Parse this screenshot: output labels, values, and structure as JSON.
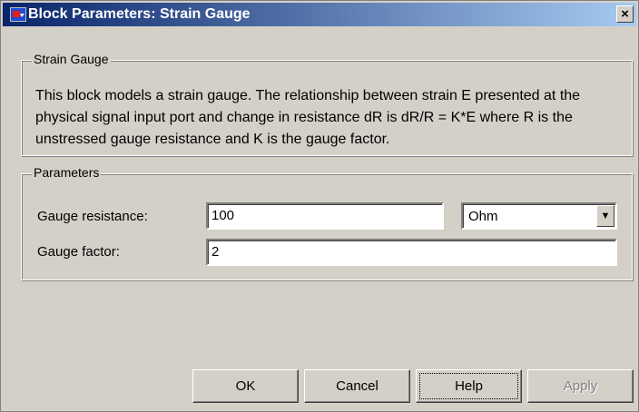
{
  "window": {
    "title": "Block Parameters: Strain Gauge",
    "app_icon": "simulink-block-icon",
    "close_glyph": "×"
  },
  "description_group": {
    "label": "Strain Gauge",
    "text": "This block models a strain gauge. The relationship between strain E presented at the physical signal input port and change in resistance dR is dR/R = K*E where R is the unstressed gauge resistance and K is the gauge factor."
  },
  "parameters_group": {
    "label": "Parameters",
    "gauge_resistance": {
      "label": "Gauge resistance:",
      "value": "100",
      "unit": "Ohm"
    },
    "gauge_factor": {
      "label": "Gauge factor:",
      "value": "2"
    }
  },
  "buttons": {
    "ok": "OK",
    "cancel": "Cancel",
    "help": "Help",
    "apply": "Apply"
  },
  "colors": {
    "dialog_bg": "#d4d0c8",
    "titlebar_start": "#0a246a",
    "titlebar_end": "#a6caf0"
  }
}
